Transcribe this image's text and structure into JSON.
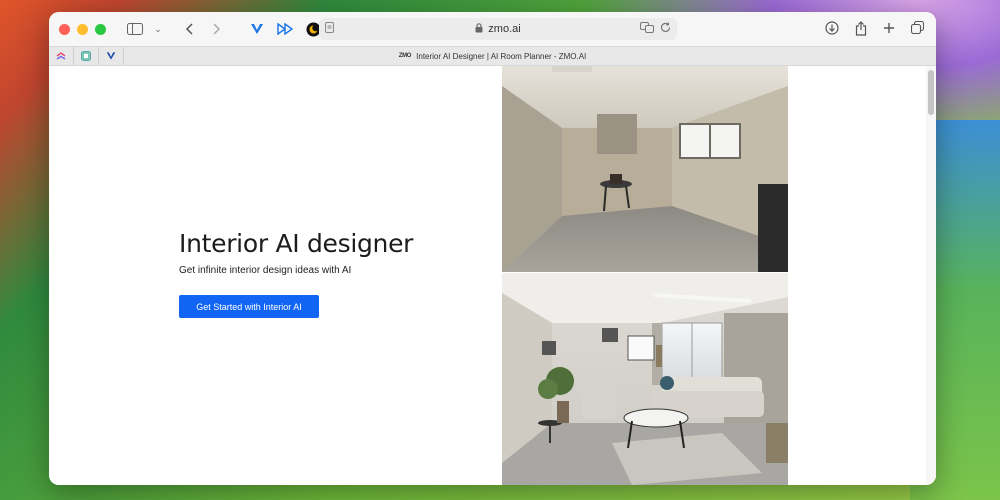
{
  "browser": {
    "url": "zmo.ai",
    "tab_title": "Interior AI Designer | AI Room Planner - ZMO.AI",
    "tab_logo_text": "ZMO"
  },
  "hero": {
    "title": "Interior AI designer",
    "subtitle": "Get infinite interior design ideas with AI",
    "cta_label": "Get Started with Interior AI"
  },
  "colors": {
    "cta": "#1264f3"
  },
  "icons": {
    "toolbar_left": [
      "sidebar-icon",
      "chevron-down-icon",
      "back-icon",
      "forward-icon"
    ],
    "extensions": [
      "vivaldi-v-icon",
      "fast-forward-icon",
      "night-mode-icon",
      "shield-check-icon"
    ],
    "toolbar_right": [
      "download-icon",
      "share-icon",
      "new-tab-icon",
      "tab-overview-icon"
    ]
  }
}
